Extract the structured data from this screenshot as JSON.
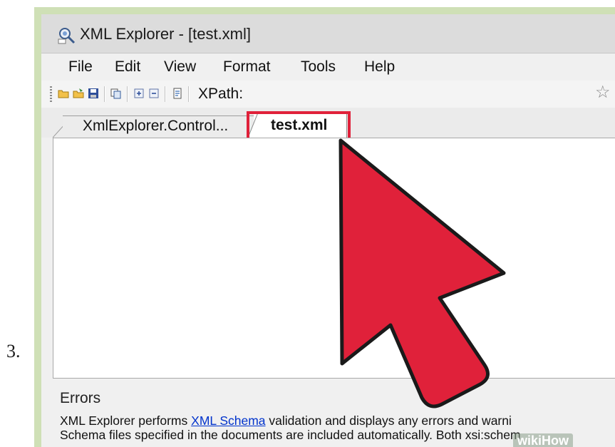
{
  "step_number": "3.",
  "window": {
    "title": "XML Explorer - [test.xml]"
  },
  "menubar": {
    "items": [
      {
        "label": "File"
      },
      {
        "label": "Edit"
      },
      {
        "label": "View"
      },
      {
        "label": "Format"
      },
      {
        "label": "Tools"
      },
      {
        "label": "Help"
      }
    ]
  },
  "toolbar": {
    "xpath_label": "XPath:",
    "buttons": [
      "open-folder-icon",
      "open-recent-icon",
      "save-icon",
      "copy-icon",
      "expand-all-icon",
      "collapse-all-icon",
      "validate-icon"
    ],
    "favorite_icon": "star-icon"
  },
  "tabs": [
    {
      "label": "XmlExplorer.Control...",
      "active": false
    },
    {
      "label": "test.xml",
      "active": true
    }
  ],
  "errors": {
    "heading": "Errors",
    "line1_before": "XML Explorer performs ",
    "line1_link": "XML Schema",
    "line1_after": " validation and displays any errors and warni",
    "line2": "Schema files specified in the documents are included automatically. Both xsi:schem"
  },
  "watermark": "wikiHow",
  "colors": {
    "highlight": "#e0213a",
    "arrow_fill": "#e0213a",
    "link": "#0033cc",
    "frame_border": "#cfe0b6"
  }
}
